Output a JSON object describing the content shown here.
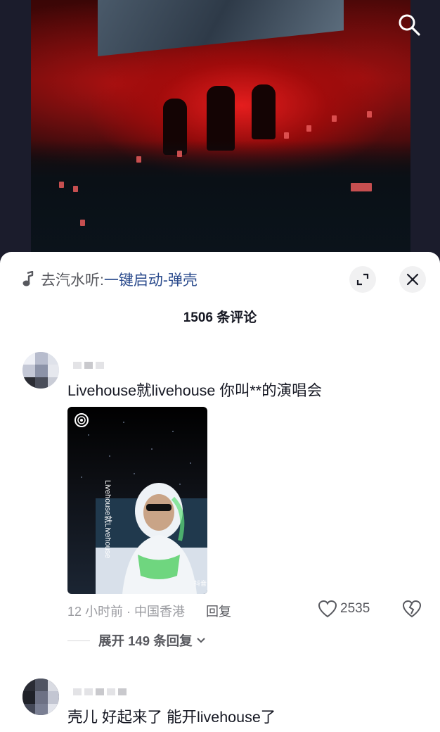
{
  "video": {
    "search_icon": "search-icon"
  },
  "sheet": {
    "music": {
      "icon": "music-note-icon",
      "prefix": "去汽水听:",
      "title": "一键启动-弹壳"
    },
    "expand_icon": "expand-icon",
    "close_icon": "close-icon",
    "comment_count": "1506 条评论"
  },
  "comments": [
    {
      "text": "Livehouse就livehouse 你叫**的演唱会",
      "image": {
        "overlay_text": "Livehouse就Livehouse",
        "watermark": "抖音",
        "live_icon": "live-ring-icon"
      },
      "meta": "12 小时前 · 中国香港",
      "reply_label": "回复",
      "likes": "2535",
      "expand_replies": "展开 149 条回复"
    },
    {
      "text": "壳儿 好起来了 能开livehouse了"
    }
  ],
  "colors": {
    "music_title": "#2a4a8c",
    "meta_gray": "#9a9ba0",
    "accent_red": "#e82a2a"
  }
}
